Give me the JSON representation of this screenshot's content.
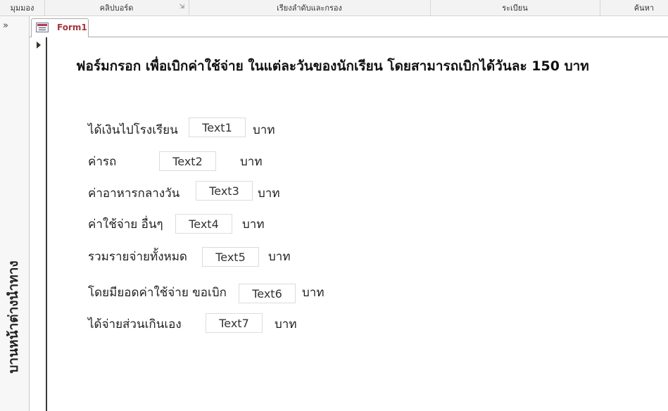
{
  "ribbon": {
    "groups": [
      "มุมมอง",
      "คลิปบอร์ด",
      "เรียงลำดับและกรอง",
      "ระเบียน",
      "ค้นหา"
    ]
  },
  "nav": {
    "toggle": "»",
    "title": "บานหน้าต่างนำทาง"
  },
  "tab": {
    "label": "Form1"
  },
  "form": {
    "heading": "ฟอร์มกรอก เพื่อเบิกค่าใช้จ่าย ในแต่ละวันของนักเรียน โดยสามารถเบิกได้วันละ 150 บาท",
    "rows": [
      {
        "label": "ได้เงินไปโรงเรียน",
        "field": "Text1",
        "unit": "บาท"
      },
      {
        "label": "ค่ารถ",
        "field": "Text2",
        "unit": "บาท"
      },
      {
        "label": "ค่าอาหารกลางวัน",
        "field": "Text3",
        "unit": "บาท"
      },
      {
        "label": "ค่าใช้จ่าย อื่นๆ",
        "field": "Text4",
        "unit": "บาท"
      },
      {
        "label": "รวมรายจ่ายทั้งหมด",
        "field": "Text5",
        "unit": "บาท"
      },
      {
        "label": "โดยมียอดค่าใช้จ่าย ขอเบิก",
        "field": "Text6",
        "unit": "บาท"
      },
      {
        "label": "ได้จ่ายส่วนเกินเอง",
        "field": "Text7",
        "unit": "บาท"
      }
    ]
  }
}
